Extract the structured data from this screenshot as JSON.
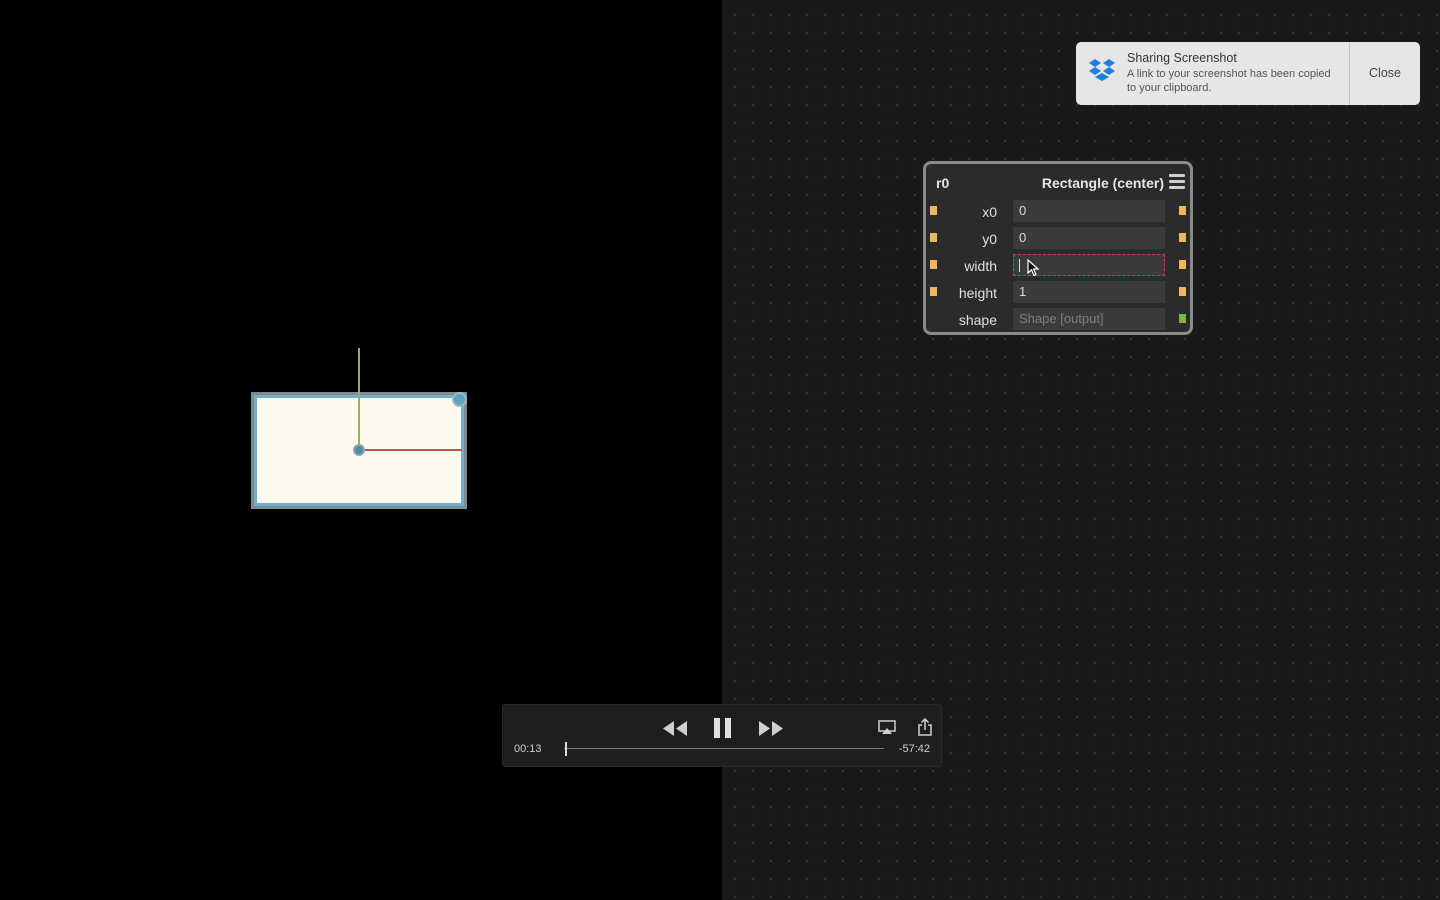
{
  "viewport": {
    "shape_fill": "#fefbee",
    "shape_stroke": "#6fb1c9"
  },
  "node": {
    "id": "r0",
    "type": "Rectangle (center)",
    "rows": [
      {
        "label": "x0",
        "value": "0"
      },
      {
        "label": "y0",
        "value": "0"
      },
      {
        "label": "width",
        "value": ""
      },
      {
        "label": "height",
        "value": "1"
      },
      {
        "label": "shape",
        "value": "Shape [output]"
      }
    ],
    "port_color": "#f0b75c",
    "output_port_color": "#79b548"
  },
  "toast": {
    "title": "Sharing Screenshot",
    "body": "A link to your screenshot has been copied to your clipboard.",
    "close_label": "Close",
    "icon": "dropbox-icon"
  },
  "player": {
    "elapsed": "00:13",
    "remaining": "-57:42",
    "progress": 0.004,
    "icons": [
      "rewind-icon",
      "pause-icon",
      "fast-forward-icon",
      "airplay-icon",
      "share-icon"
    ]
  }
}
